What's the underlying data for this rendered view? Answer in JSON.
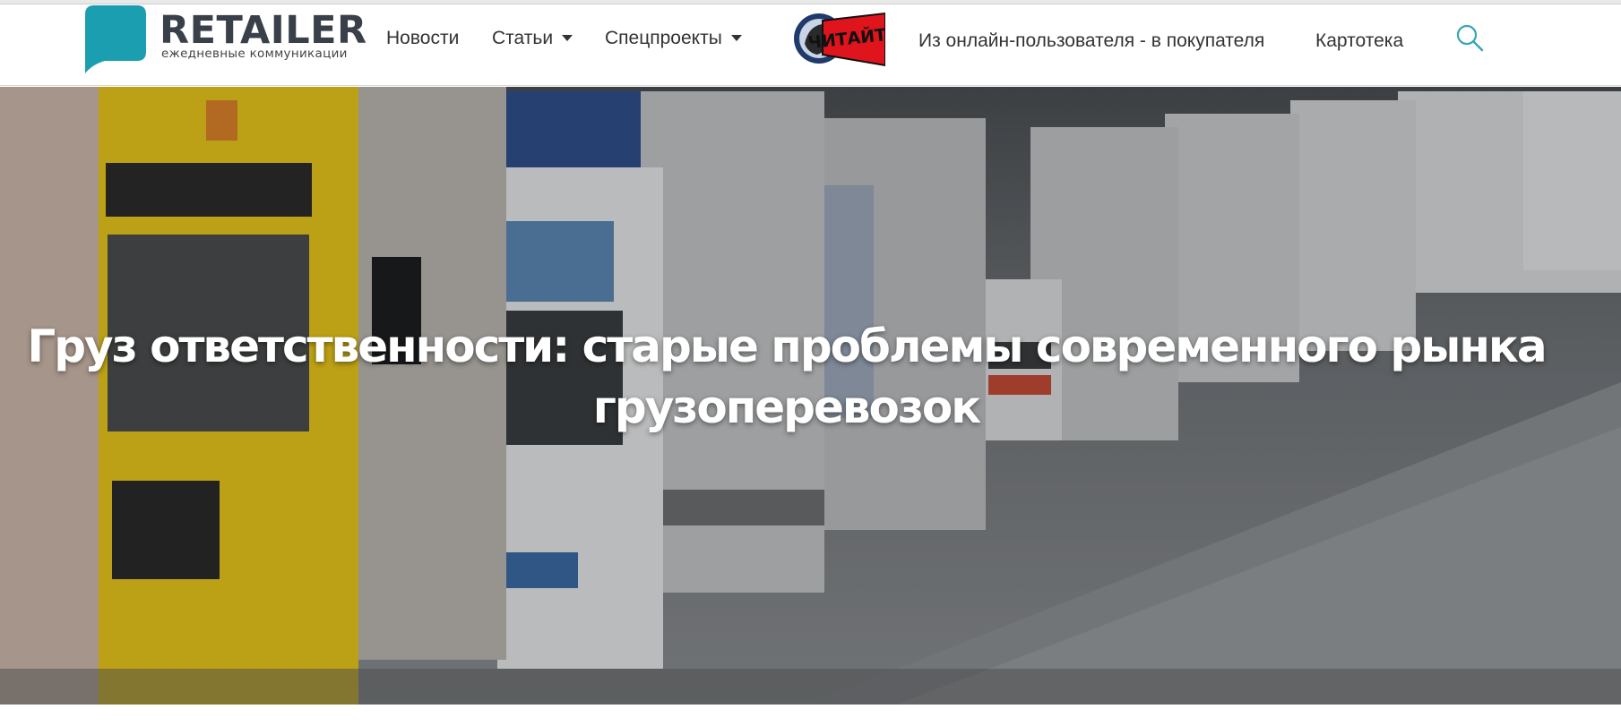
{
  "logo": {
    "title": "RETAILER",
    "subtitle": "ежедневные коммуникации",
    "brand_color": "#1b9fb0"
  },
  "nav": {
    "items": [
      {
        "label": "Новости",
        "has_dropdown": false
      },
      {
        "label": "Статьи",
        "has_dropdown": true
      },
      {
        "label": "Спецпроекты",
        "has_dropdown": true
      },
      {
        "label": "Из онлайн-пользователя - в покупателя",
        "has_dropdown": false
      },
      {
        "label": "Картотека",
        "has_dropdown": false
      }
    ],
    "promo_badge_text": "ЧИТАЙТЕ",
    "search_icon": "search-icon"
  },
  "hero": {
    "title_line1": "Груз ответственности: старые проблемы современного рынка",
    "title_line2": "грузоперевозок"
  },
  "colors": {
    "accent": "#1b9fb0",
    "promo_red": "#e0141c",
    "search_icon": "#3aa3b5"
  }
}
